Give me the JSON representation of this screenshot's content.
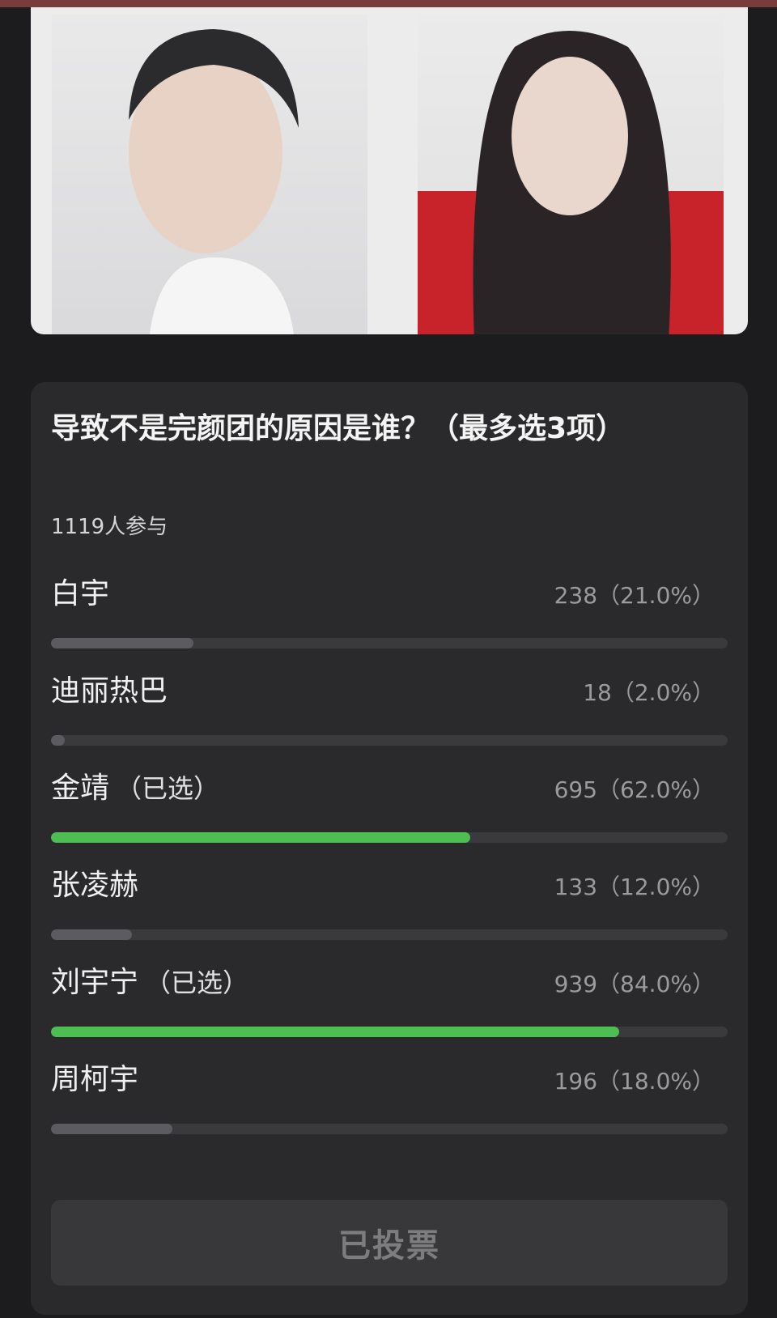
{
  "poll": {
    "title": "导致不是完颜团的原因是谁？（最多选3项）",
    "participants": "1119人参与",
    "options": [
      {
        "name": "白宇",
        "selected_label": "",
        "count_label": "238（21.0%）",
        "percent": 21.0,
        "selected": false
      },
      {
        "name": "迪丽热巴",
        "selected_label": "",
        "count_label": "18（2.0%）",
        "percent": 2.0,
        "selected": false
      },
      {
        "name": "金靖",
        "selected_label": "（已选）",
        "count_label": "695（62.0%）",
        "percent": 62.0,
        "selected": true
      },
      {
        "name": "张凌赫",
        "selected_label": "",
        "count_label": "133（12.0%）",
        "percent": 12.0,
        "selected": false
      },
      {
        "name": "刘宇宁",
        "selected_label": "（已选）",
        "count_label": "939（84.0%）",
        "percent": 84.0,
        "selected": true
      },
      {
        "name": "周柯宇",
        "selected_label": "",
        "count_label": "196（18.0%）",
        "percent": 18.0,
        "selected": false
      }
    ],
    "vote_button": "已投票"
  },
  "colors": {
    "selected_bar": "#4cbe52",
    "unselected_bar": "#5c5c60",
    "card_background": "#2a2a2d",
    "page_background": "#1c1c1e"
  }
}
